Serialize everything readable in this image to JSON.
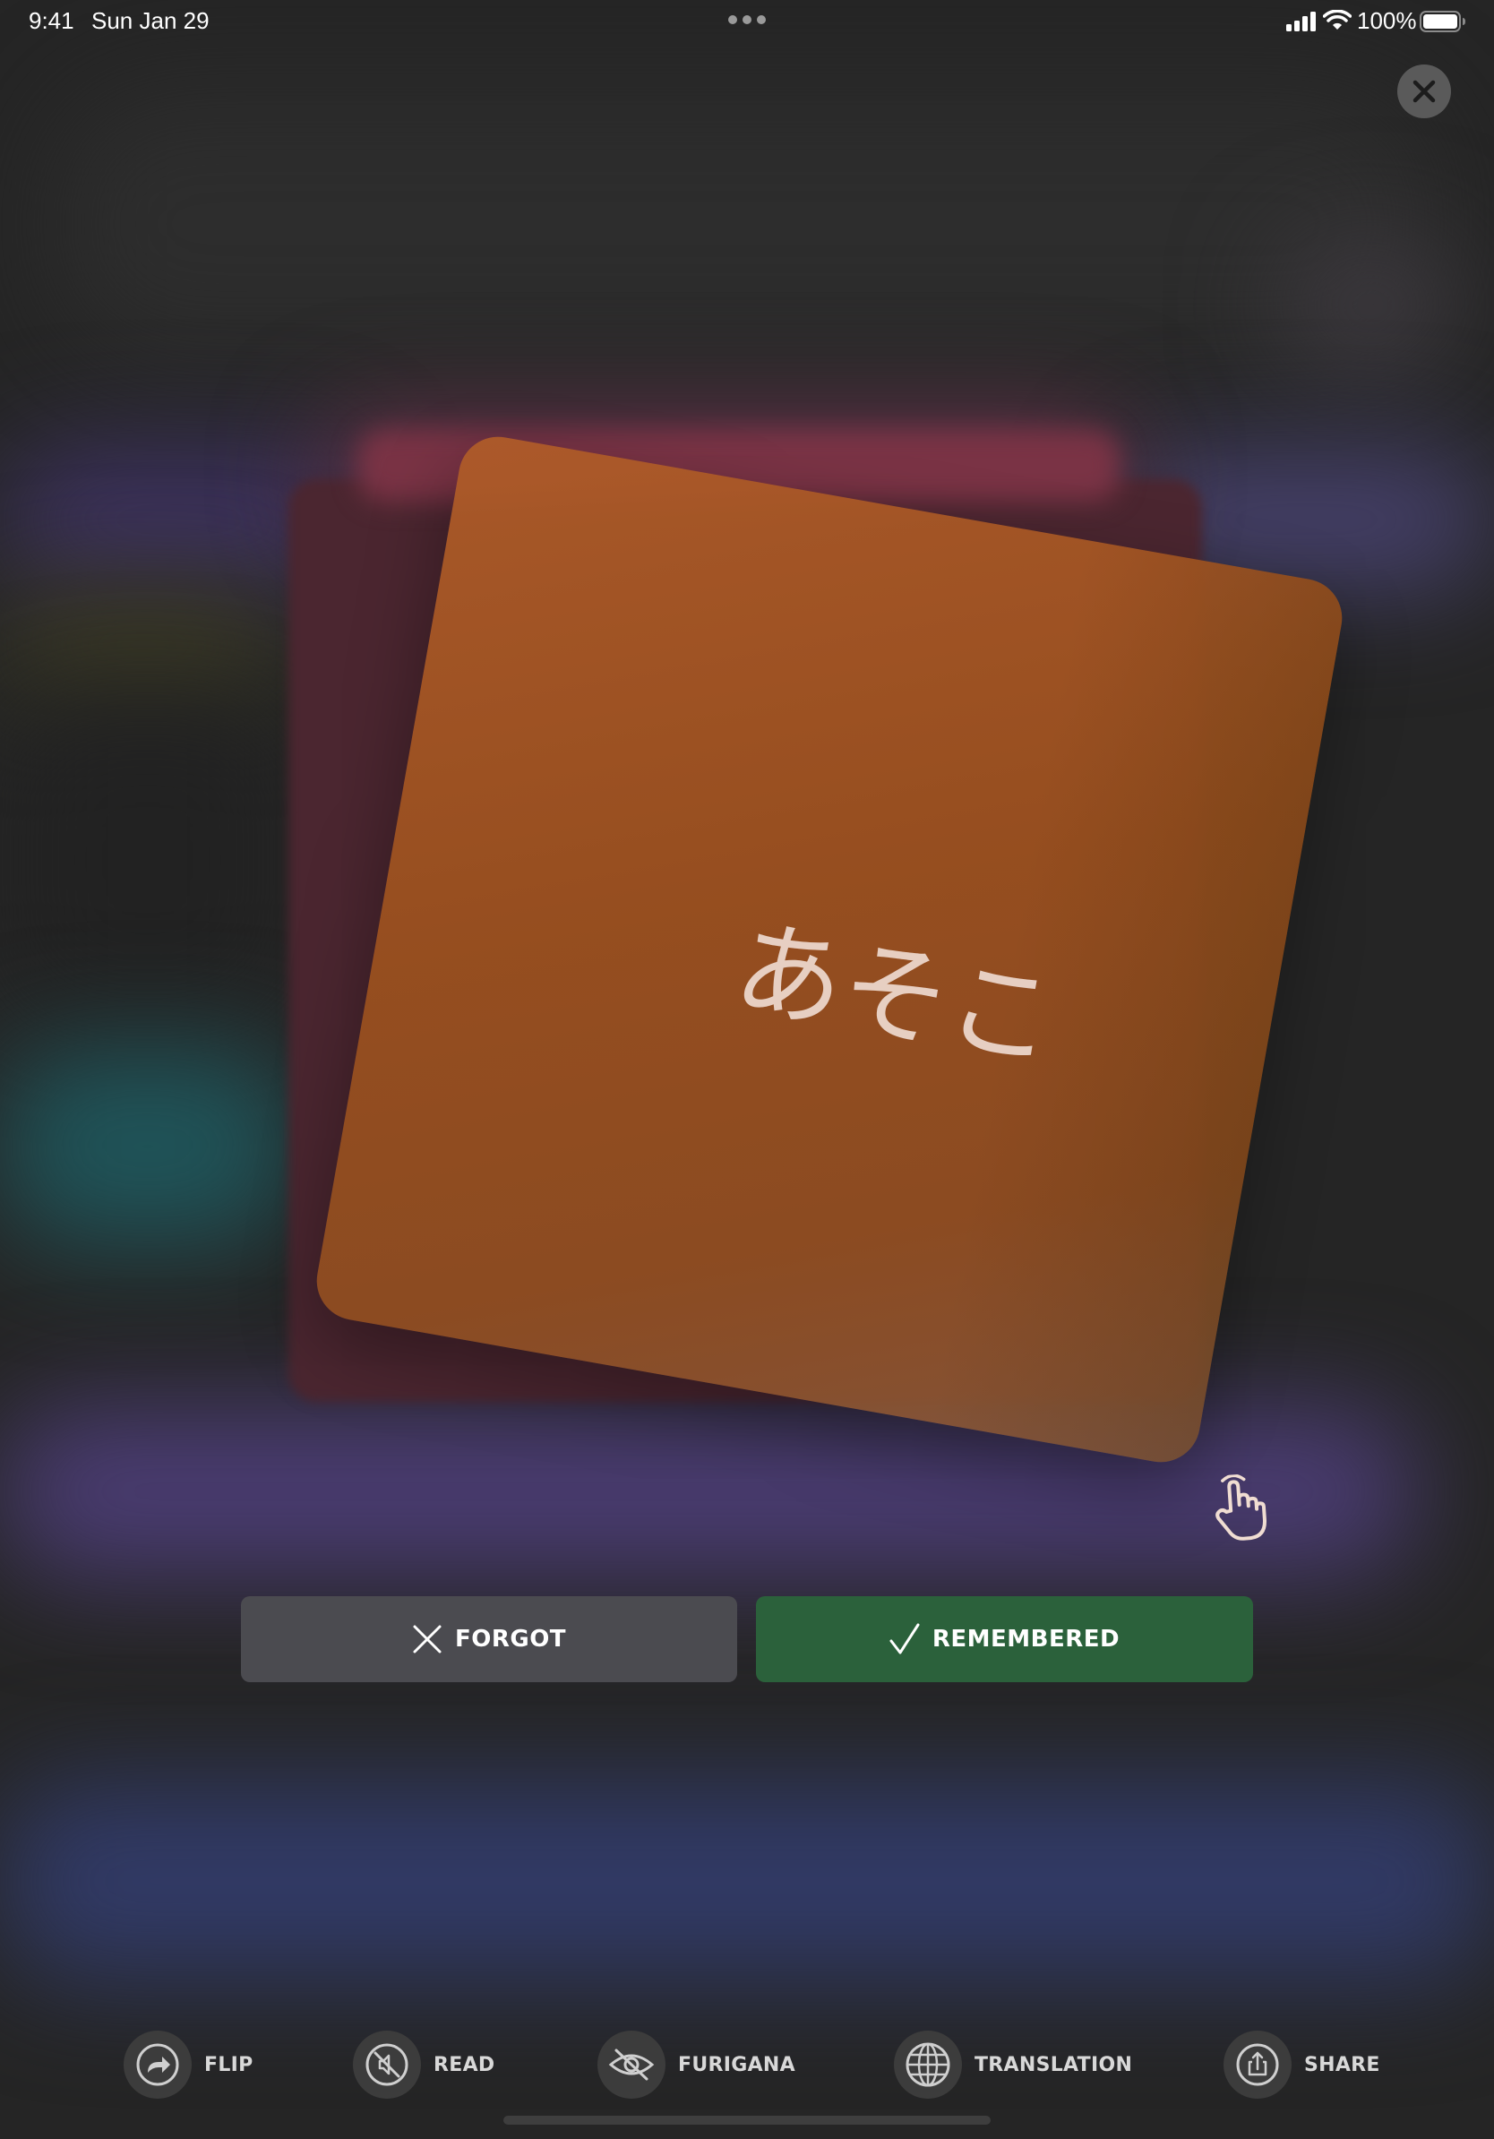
{
  "status_bar": {
    "time": "9:41",
    "date": "Sun Jan 29",
    "battery_percent": "100%",
    "icons": [
      "multitasking-dots-icon",
      "cellular-signal-icon",
      "wifi-icon",
      "battery-icon"
    ]
  },
  "close_button": {
    "icon": "close-icon"
  },
  "card": {
    "word": "あそこ",
    "color": "#a4562a",
    "hint_icon": "tap-hand-icon"
  },
  "answers": {
    "forgot": {
      "label": "FORGOT",
      "icon": "x-icon",
      "color": "#4b4b50"
    },
    "remembered": {
      "label": "REMEMBERED",
      "icon": "checkmark-icon",
      "color": "#2b613b"
    }
  },
  "toolbar": {
    "items": [
      {
        "label": "FLIP",
        "icon": "flip-arrow-icon"
      },
      {
        "label": "READ",
        "icon": "speaker-muted-icon"
      },
      {
        "label": "FURIGANA",
        "icon": "eye-slash-icon"
      },
      {
        "label": "TRANSLATION",
        "icon": "globe-icon"
      },
      {
        "label": "SHARE",
        "icon": "share-icon"
      }
    ]
  }
}
